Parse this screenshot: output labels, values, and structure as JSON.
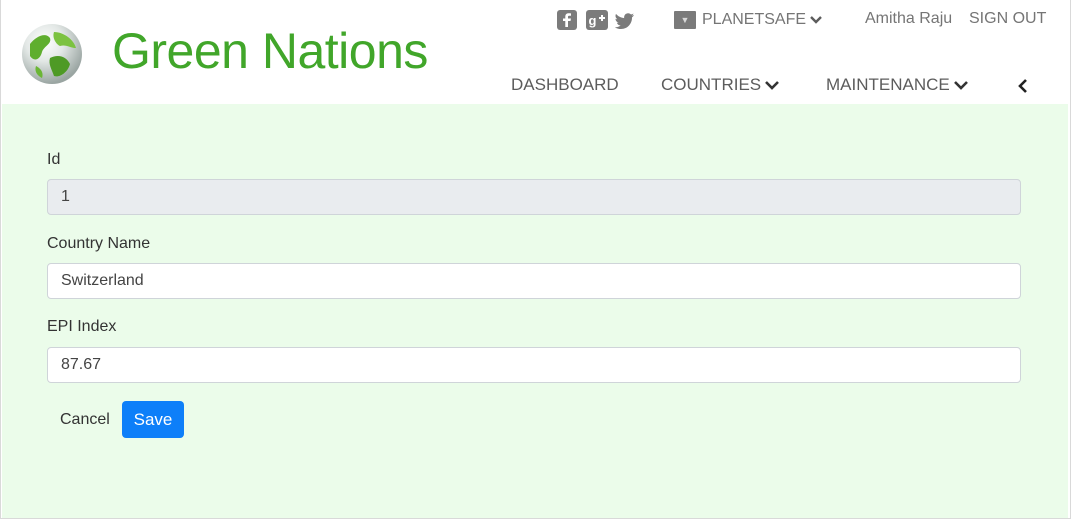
{
  "brand": {
    "name": "Green Nations",
    "color": "#41a62a"
  },
  "social": {
    "icons": [
      "facebook-icon",
      "google-plus-icon",
      "twitter-icon"
    ]
  },
  "topbar": {
    "org_label": "PLANETSAFE",
    "user_name": "Amitha Raju",
    "sign_out_label": "SIGN OUT"
  },
  "nav": {
    "dashboard": "DASHBOARD",
    "countries": "COUNTRIES",
    "maintenance": "MAINTENANCE"
  },
  "form": {
    "id_label": "Id",
    "id_value": "1",
    "country_label": "Country Name",
    "country_value": "Switzerland",
    "epi_label": "EPI Index",
    "epi_value": "87.67",
    "cancel_label": "Cancel",
    "save_label": "Save"
  },
  "colors": {
    "background": "#ebfcea",
    "primary_button": "#0d7ff9"
  }
}
